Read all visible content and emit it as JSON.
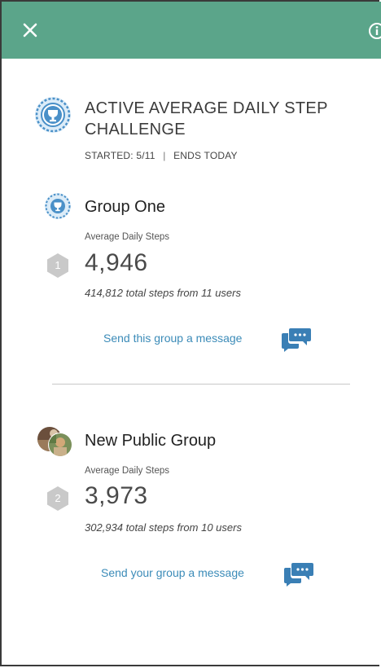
{
  "challenge": {
    "title": "ACTIVE AVERAGE DAILY STEP CHALLENGE",
    "started_label": "STARTED: 5/11",
    "separator": "|",
    "ends_label": "ENDS TODAY"
  },
  "groups": [
    {
      "name": "Group One",
      "metric_label": "Average Daily Steps",
      "rank": "1",
      "steps": "4,946",
      "total_text": "414,812 total steps from 11 users",
      "message_label": "Send this group a message"
    },
    {
      "name": "New Public Group",
      "metric_label": "Average Daily Steps",
      "rank": "2",
      "steps": "3,973",
      "total_text": "302,934 total steps from 10 users",
      "message_label": "Send your group a message"
    }
  ],
  "colors": {
    "header": "#5ba58a",
    "link": "#3b8bb8",
    "chat_icon": "#3a7fb5",
    "badge_blue": "#4a90c8",
    "rank_badge": "#c9c9c9"
  },
  "icons": {
    "close": "close-icon",
    "info": "info-icon",
    "challenge": "trophy-badge-icon",
    "message": "chat-bubbles-icon"
  }
}
